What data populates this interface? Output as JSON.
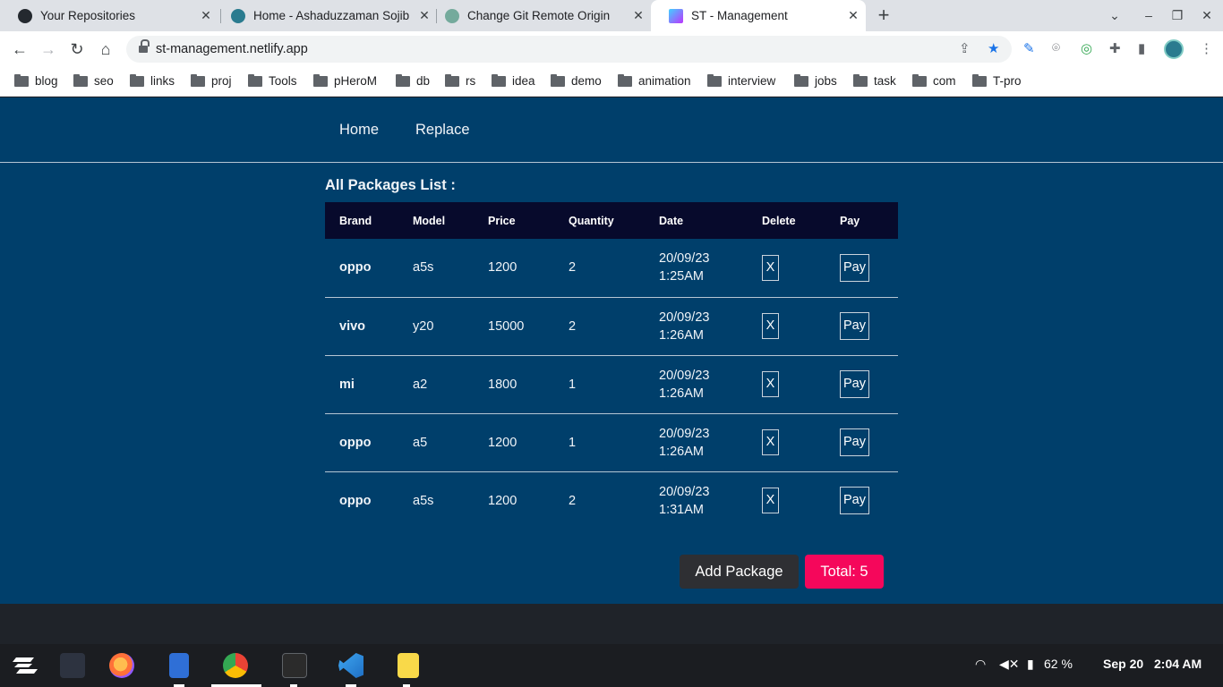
{
  "browser": {
    "tabs": [
      {
        "title": "Your Repositories",
        "favicon": "github-icon"
      },
      {
        "title": "Home - Ashaduzzaman Sojib",
        "favicon": "profile-icon"
      },
      {
        "title": "Change Git Remote Origin",
        "favicon": "openai-icon"
      },
      {
        "title": "ST - Management",
        "favicon": "vite-icon",
        "active": true
      }
    ],
    "new_tab": "+",
    "url": "st-management.netlify.app",
    "bookmarks": [
      "blog",
      "seo",
      "links",
      "proj",
      "Tools",
      "pHeroM",
      "db",
      "rs",
      "idea",
      "demo",
      "animation",
      "interview",
      "jobs",
      "task",
      "com",
      "T-pro"
    ]
  },
  "nav": {
    "home": "Home",
    "replace": "Replace"
  },
  "list_title": "All Packages List :",
  "table": {
    "headers": [
      "Brand",
      "Model",
      "Price",
      "Quantity",
      "Date",
      "Delete",
      "Pay"
    ],
    "rows": [
      {
        "brand": "oppo",
        "model": "a5s",
        "price": "1200",
        "quantity": "2",
        "date": "20/09/23",
        "time": "1:25AM"
      },
      {
        "brand": "vivo",
        "model": "y20",
        "price": "15000",
        "quantity": "2",
        "date": "20/09/23",
        "time": "1:26AM"
      },
      {
        "brand": "mi",
        "model": "a2",
        "price": "1800",
        "quantity": "1",
        "date": "20/09/23",
        "time": "1:26AM"
      },
      {
        "brand": "oppo",
        "model": "a5",
        "price": "1200",
        "quantity": "1",
        "date": "20/09/23",
        "time": "1:26AM"
      },
      {
        "brand": "oppo",
        "model": "a5s",
        "price": "1200",
        "quantity": "2",
        "date": "20/09/23",
        "time": "1:31AM"
      }
    ],
    "delete_label": "X",
    "pay_label": "Pay"
  },
  "actions": {
    "add_package": "Add Package",
    "total": "Total: 5"
  },
  "taskbar": {
    "battery": "62 %",
    "date": "Sep 20",
    "time": "2:04 AM"
  },
  "colors": {
    "page_bg": "#003f6b",
    "table_header_bg": "#070a2c",
    "total_button": "#f5075b",
    "add_button": "#2e2f33"
  }
}
